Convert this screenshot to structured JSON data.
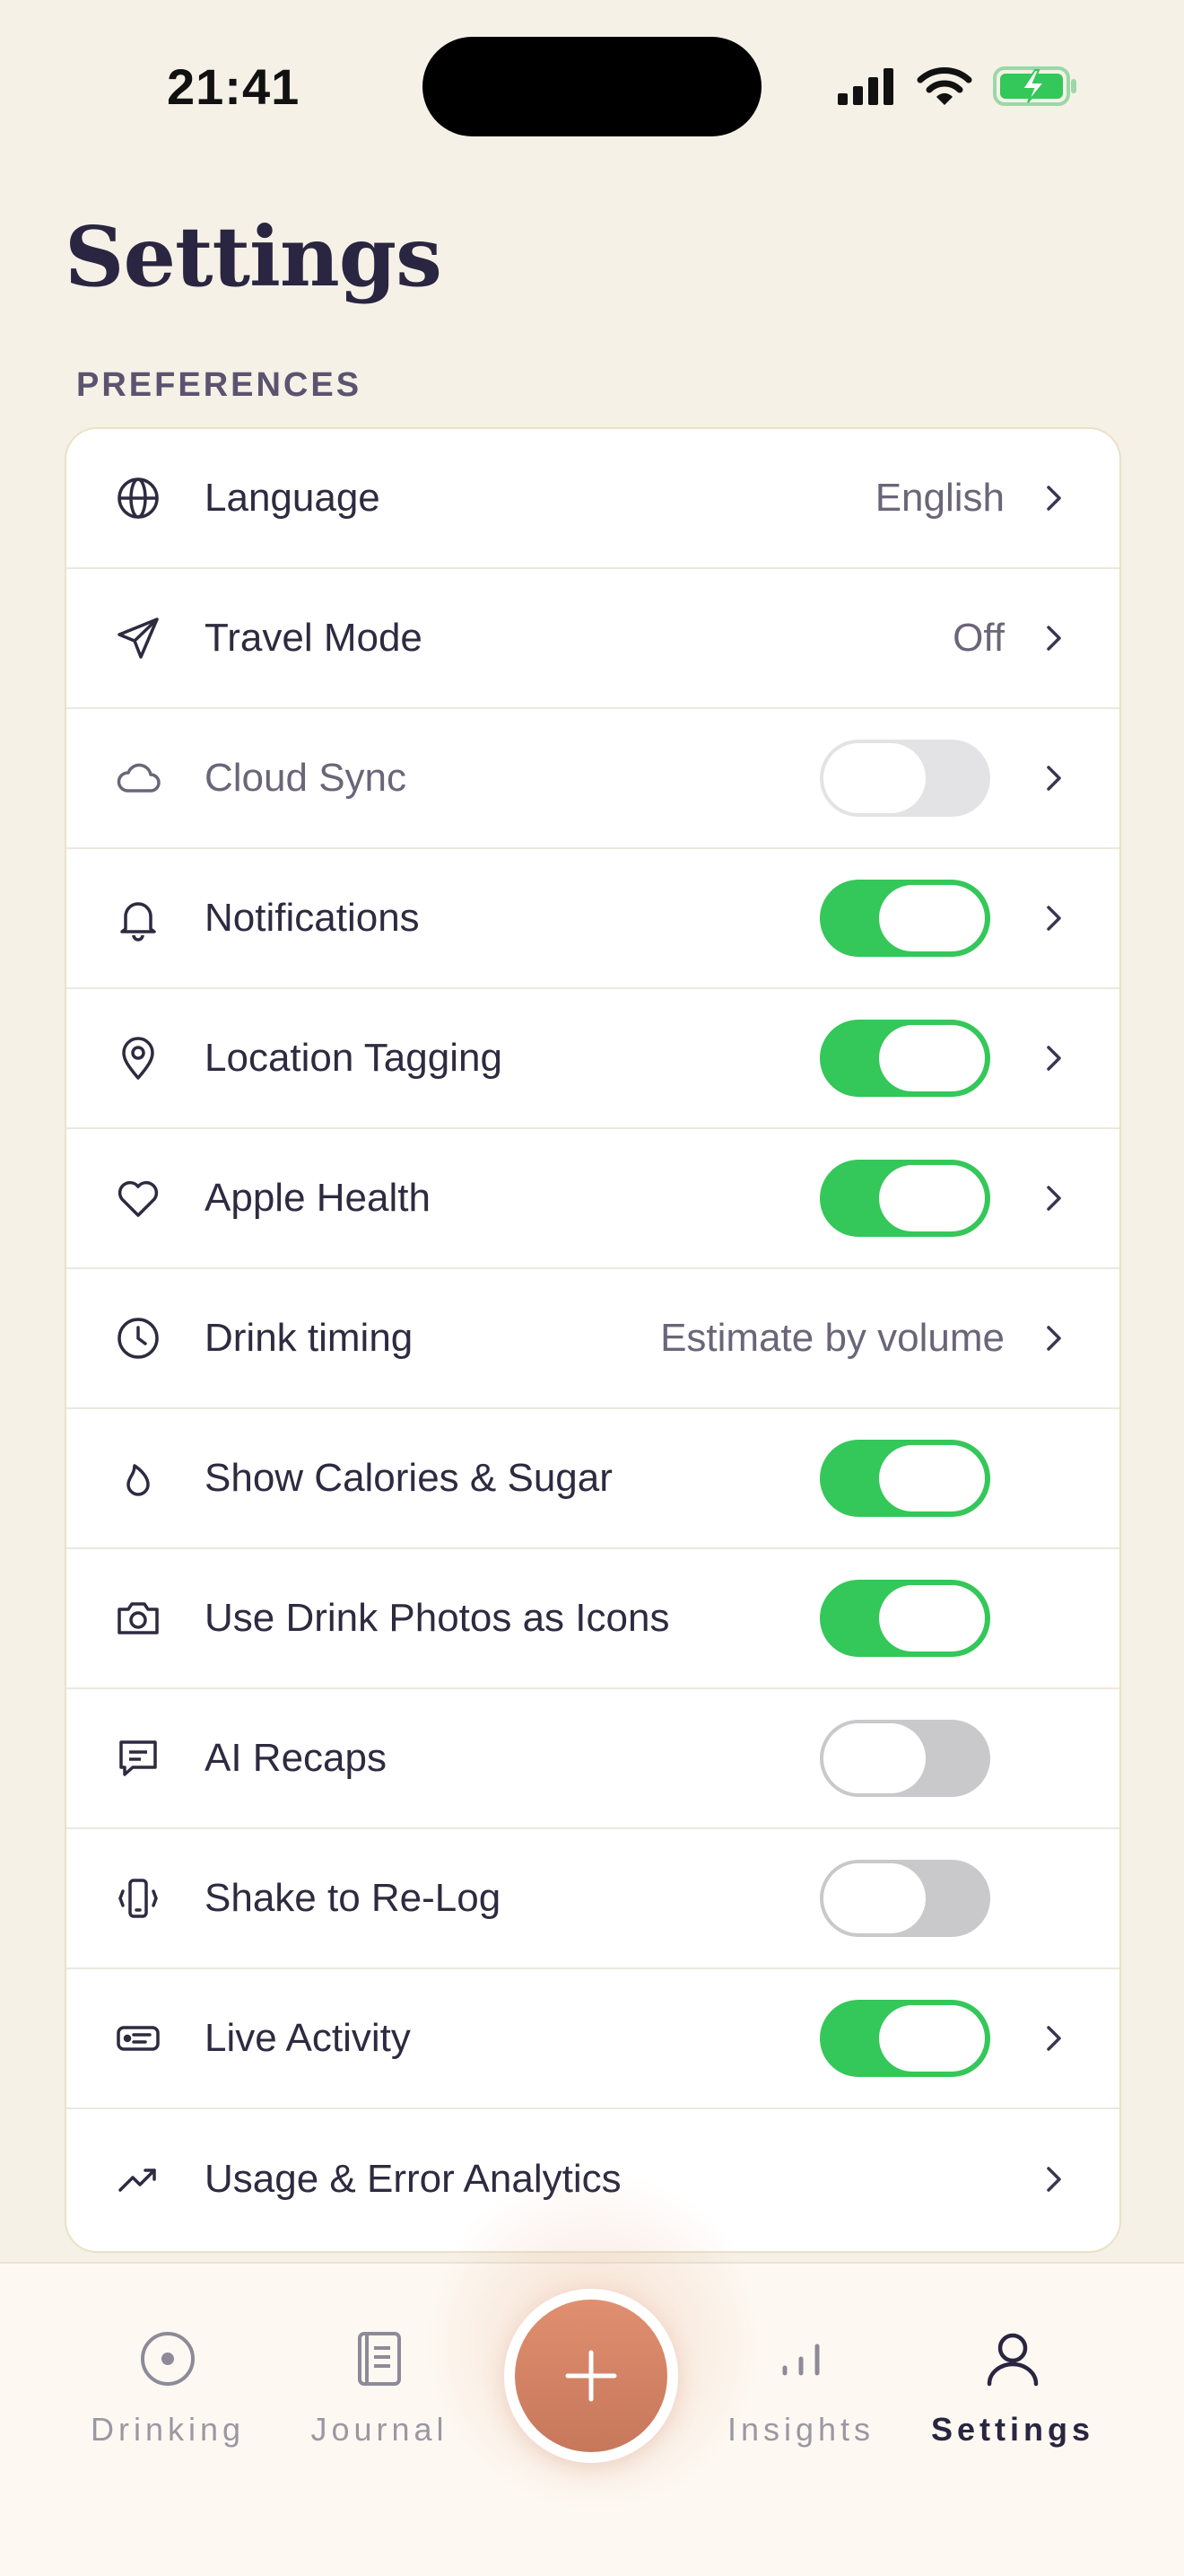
{
  "status": {
    "time": "21:41"
  },
  "header": {
    "title": "Settings"
  },
  "section": {
    "label": "PREFERENCES"
  },
  "rows": [
    {
      "label": "Language",
      "value": "English"
    },
    {
      "label": "Travel Mode",
      "value": "Off"
    },
    {
      "label": "Cloud Sync",
      "toggle": "off"
    },
    {
      "label": "Notifications",
      "toggle": "on"
    },
    {
      "label": "Location Tagging",
      "toggle": "on"
    },
    {
      "label": "Apple Health",
      "toggle": "on"
    },
    {
      "label": "Drink timing",
      "value": "Estimate by volume"
    },
    {
      "label": "Show Calories & Sugar",
      "toggle": "on"
    },
    {
      "label": "Use Drink Photos as Icons",
      "toggle": "on"
    },
    {
      "label": "AI Recaps",
      "toggle": "off"
    },
    {
      "label": "Shake to Re-Log",
      "toggle": "off"
    },
    {
      "label": "Live Activity",
      "toggle": "on"
    },
    {
      "label": "Usage & Error Analytics"
    }
  ],
  "tabs": [
    {
      "label": "Drinking",
      "icon": "target-icon"
    },
    {
      "label": "Journal",
      "icon": "journal-icon"
    },
    {
      "label": "Insights",
      "icon": "bars-icon"
    },
    {
      "label": "Settings",
      "icon": "person-icon"
    }
  ],
  "colors": {
    "toggle_on": "#34c759",
    "accent": "#d4805f",
    "background": "#f6f1e7"
  }
}
